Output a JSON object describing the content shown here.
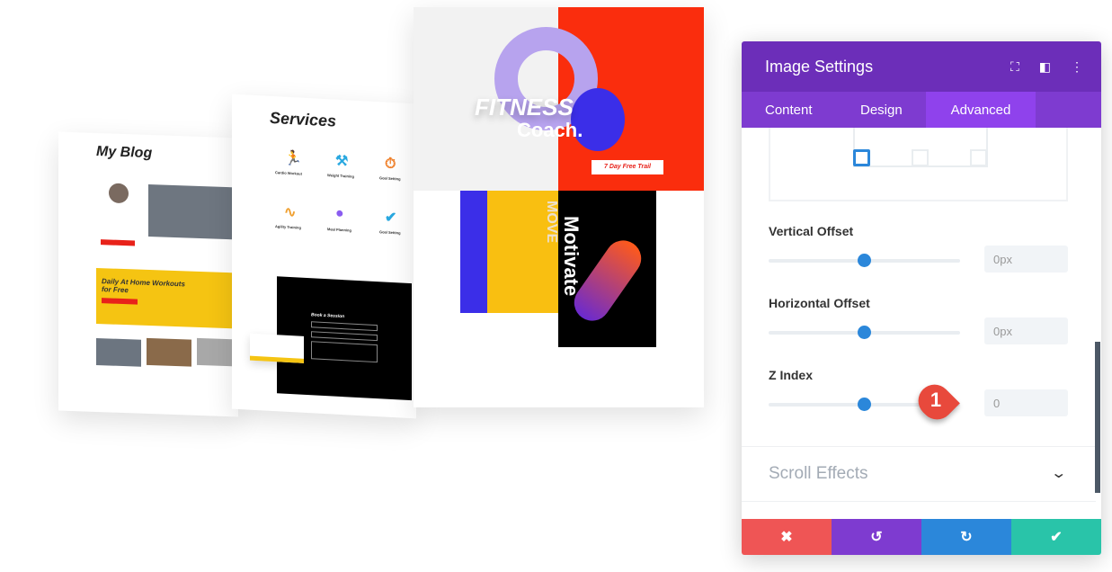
{
  "mockups": {
    "blog": {
      "title": "My Blog",
      "banner": "Daily At Home Workouts for Free"
    },
    "services": {
      "title": "Services",
      "items": [
        "Cardio Workout",
        "Weight Training",
        "Goal Setting",
        "Agility Training",
        "Meal Planning",
        "Goal Setting"
      ],
      "form_title": "Book a Session"
    },
    "fitness": {
      "hero1": "FITNESS",
      "hero2": "Coach.",
      "cta": "7 Day Free Trail",
      "vertical1": "MOVE",
      "vertical2": "Motivate"
    }
  },
  "panel": {
    "title": "Image Settings",
    "header_icons": [
      "fullscreen-icon",
      "sidebar-icon",
      "more-icon"
    ],
    "tabs": [
      {
        "label": "Content"
      },
      {
        "label": "Design"
      },
      {
        "label": "Advanced",
        "active": true
      }
    ],
    "fields": [
      {
        "label": "Vertical Offset",
        "value": "0px"
      },
      {
        "label": "Horizontal Offset",
        "value": "0px"
      },
      {
        "label": "Z Index",
        "value": "0"
      }
    ],
    "callout": "1",
    "section": "Scroll Effects",
    "footer": {
      "cancel": "✖",
      "undo": "↺",
      "redo": "↻",
      "save": "✔"
    },
    "colors": {
      "header": "#6c2eb9",
      "tabs": "#7e3bd0",
      "active_tab": "#8f42ec",
      "cancel": "#ef5555",
      "undo": "#7e3bd0",
      "redo": "#2b87da",
      "save": "#29c4a9",
      "callout": "#e8493c"
    }
  }
}
